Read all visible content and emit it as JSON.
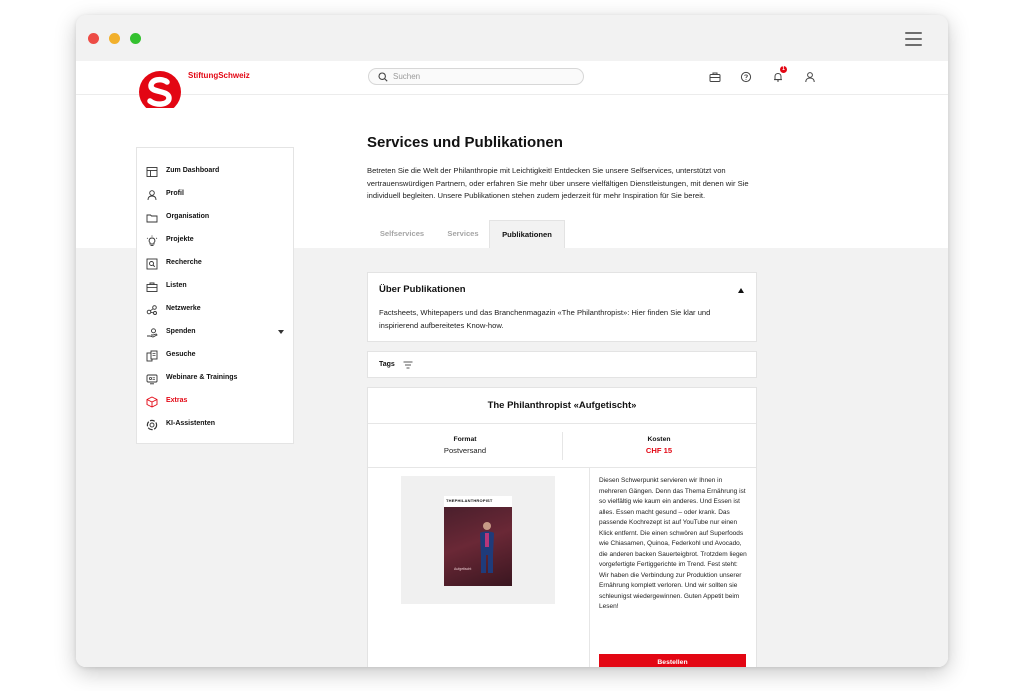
{
  "brand": {
    "name": "StiftungSchweiz",
    "color": "#e30613"
  },
  "search": {
    "placeholder": "Suchen",
    "value": ""
  },
  "topbar_icons": [
    "briefcase-icon",
    "help-icon",
    "bell-icon",
    "user-icon"
  ],
  "notifications": {
    "count": "1"
  },
  "sidebar": {
    "items": [
      {
        "label": "Zum Dashboard",
        "icon": "dashboard-icon"
      },
      {
        "label": "Profil",
        "icon": "user-icon"
      },
      {
        "label": "Organisation",
        "icon": "folder-icon"
      },
      {
        "label": "Projekte",
        "icon": "lightbulb-icon"
      },
      {
        "label": "Recherche",
        "icon": "search-box-icon"
      },
      {
        "label": "Listen",
        "icon": "list-icon"
      },
      {
        "label": "Netzwerke",
        "icon": "network-icon"
      },
      {
        "label": "Spenden",
        "icon": "donate-icon"
      },
      {
        "label": "Gesuche",
        "icon": "documents-icon"
      },
      {
        "label": "Webinare & Trainings",
        "icon": "webinar-icon"
      },
      {
        "label": "Extras",
        "icon": "cube-icon"
      },
      {
        "label": "KI-Assistenten",
        "icon": "ai-icon"
      }
    ]
  },
  "main": {
    "title": "Services und Publikationen",
    "intro": "Betreten Sie die Welt der Philanthropie mit Leichtigkeit! Entdecken Sie unsere Selfservices, unterstützt von vertrauenswürdigen Partnern, oder erfahren Sie mehr über unsere vielfältigen Dienstleistungen, mit denen wir Sie individuell begleiten. Unsere Publikationen stehen zudem jederzeit für mehr Inspiration für Sie bereit.",
    "tabs": [
      {
        "label": "Selfservices",
        "active": false
      },
      {
        "label": "Services",
        "active": false
      },
      {
        "label": "Publikationen",
        "active": true
      }
    ],
    "about": {
      "title": "Über Publikationen",
      "text": "Factsheets, Whitepapers und das Branchenmagazin «The Philanthropist»: Hier finden Sie klar und inspirierend aufbereitetes Know-how."
    },
    "tags": {
      "label": "Tags"
    },
    "publication": {
      "title": "The Philanthropist «Aufgetischt»",
      "format_label": "Format",
      "format_value": "Postversand",
      "cost_label": "Kosten",
      "cost_value": "CHF 15",
      "cover_header": "THEPHILANTHROPIST",
      "cover_caption": "Aufgetischt",
      "description": "Diesen Schwerpunkt servieren wir Ihnen in mehreren Gängen. Denn das Thema Ernährung ist so vielfältig wie kaum ein anderes. Und Essen ist alles. Essen macht gesund – oder krank. Das passende Kochrezept ist auf YouTube nur einen Klick entfernt. Die einen schwören auf Superfoods wie Chiasamen, Quinoa, Federkohl und Avocado, die anderen backen Sauerteigbrot. Trotzdem liegen vorgefertigte Fertiggerichte im Trend. Fest steht: Wir haben die Verbindung zur Produktion unserer Ernährung komplett verloren. Und wir sollten sie schleunigst wiedergewinnen. Guten Appetit beim Lesen!",
      "order_label": "Bestellen"
    }
  }
}
